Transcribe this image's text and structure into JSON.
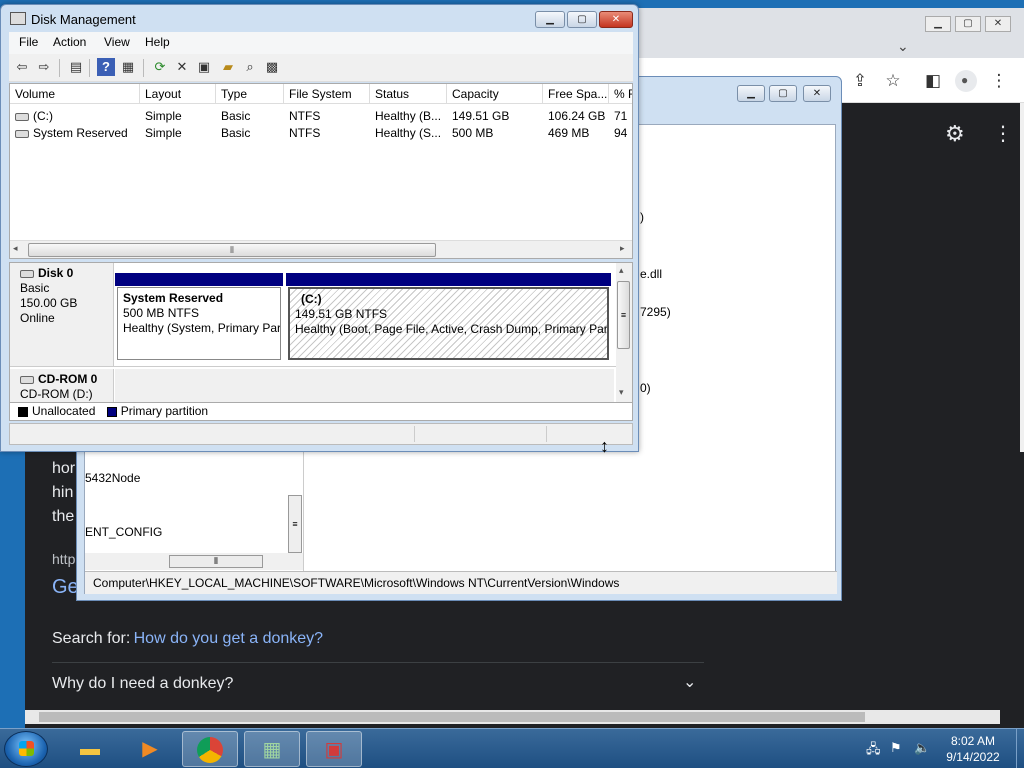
{
  "chrome": {
    "search_for_label": "Search for:",
    "search_link": "How do you get a donkey?",
    "faq_item": "Why do I need a donkey?",
    "settings_icon": "gear-icon",
    "partial_texts": [
      "hor",
      "hin",
      "the",
      "http",
      "Ge"
    ],
    "behind_texts": [
      ")",
      "e.dll",
      "7295)",
      "0)"
    ]
  },
  "regedit": {
    "tree_items": [
      "5432Node",
      "ENT_CONFIG"
    ],
    "status_path": "Computer\\HKEY_LOCAL_MACHINE\\SOFTWARE\\Microsoft\\Windows NT\\CurrentVersion\\Windows"
  },
  "disk_mgmt": {
    "title": "Disk Management",
    "menu": [
      "File",
      "Action",
      "View",
      "Help"
    ],
    "columns": [
      "Volume",
      "Layout",
      "Type",
      "File System",
      "Status",
      "Capacity",
      "Free Spa...",
      "% F"
    ],
    "volumes": [
      [
        "(C:)",
        "Simple",
        "Basic",
        "NTFS",
        "Healthy (B...",
        "149.51 GB",
        "106.24 GB",
        "71"
      ],
      [
        "System Reserved",
        "Simple",
        "Basic",
        "NTFS",
        "Healthy (S...",
        "500 MB",
        "469 MB",
        "94"
      ]
    ],
    "disk0": {
      "name": "Disk 0",
      "type": "Basic",
      "size": "150.00 GB",
      "state": "Online",
      "partitions": [
        {
          "name": "System Reserved",
          "size": "500 MB NTFS",
          "status": "Healthy (System, Primary Par"
        },
        {
          "name": "(C:)",
          "size": "149.51 GB NTFS",
          "status": "Healthy (Boot, Page File, Active, Crash Dump, Primary Parti"
        }
      ]
    },
    "cdrom": {
      "name": "CD-ROM 0",
      "drive": "CD-ROM (D:)"
    },
    "legend": [
      "Unallocated",
      "Primary partition"
    ],
    "colors": {
      "unallocated": "#000000",
      "primary": "#000080"
    }
  },
  "taskbar": {
    "time": "8:02 AM",
    "date": "9/14/2022"
  }
}
